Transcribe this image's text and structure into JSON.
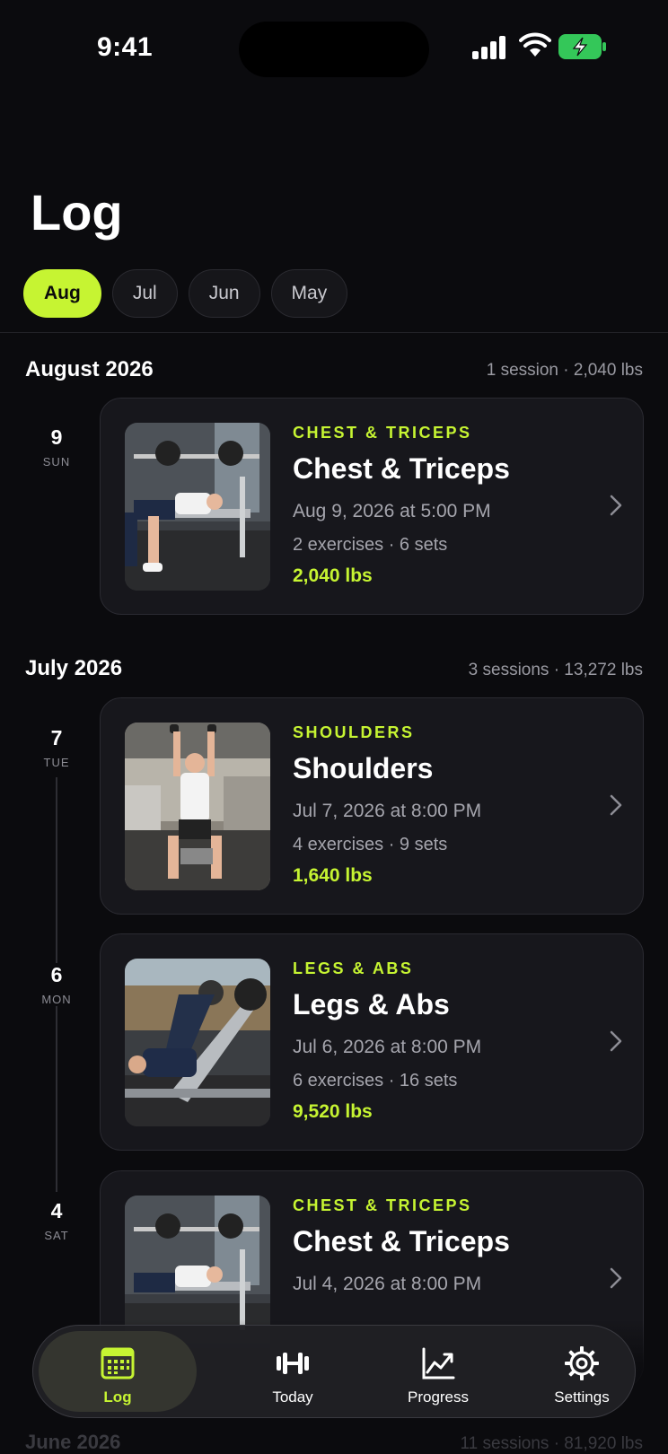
{
  "status": {
    "time": "9:41"
  },
  "page": {
    "title": "Log"
  },
  "month_tabs": [
    {
      "label": "Aug",
      "active": true
    },
    {
      "label": "Jul",
      "active": false
    },
    {
      "label": "Jun",
      "active": false
    },
    {
      "label": "May",
      "active": false
    }
  ],
  "sections": [
    {
      "title": "August 2026",
      "summary": "1 session · 2,040 lbs",
      "sessions": [
        {
          "day": "9",
          "dow": "SUN",
          "category": "CHEST & TRICEPS",
          "name": "Chest & Triceps",
          "datetime": "Aug 9, 2026 at 5:00 PM",
          "meta": "2 exercises · 6 sets",
          "volume": "2,040 lbs"
        }
      ]
    },
    {
      "title": "July 2026",
      "summary": "3 sessions · 13,272 lbs",
      "sessions": [
        {
          "day": "7",
          "dow": "TUE",
          "category": "SHOULDERS",
          "name": "Shoulders",
          "datetime": "Jul 7, 2026 at 8:00 PM",
          "meta": "4 exercises · 9 sets",
          "volume": "1,640 lbs"
        },
        {
          "day": "6",
          "dow": "MON",
          "category": "LEGS & ABS",
          "name": "Legs & Abs",
          "datetime": "Jul 6, 2026 at 8:00 PM",
          "meta": "6 exercises · 16 sets",
          "volume": "9,520 lbs"
        },
        {
          "day": "4",
          "dow": "SAT",
          "category": "CHEST & TRICEPS",
          "name": "Chest & Triceps",
          "datetime": "Jul 4, 2026 at 8:00 PM"
        }
      ]
    },
    {
      "title": "June 2026",
      "summary": "11 sessions · 81,920 lbs"
    }
  ],
  "tabbar": [
    {
      "label": "Log",
      "icon": "calendar-icon",
      "active": true
    },
    {
      "label": "Today",
      "icon": "dumbbell-icon",
      "active": false
    },
    {
      "label": "Progress",
      "icon": "chart-line-icon",
      "active": false
    },
    {
      "label": "Settings",
      "icon": "gear-icon",
      "active": false
    }
  ],
  "colors": {
    "accent": "#c6f432",
    "background": "#0b0b0e",
    "card": "#17171c"
  }
}
